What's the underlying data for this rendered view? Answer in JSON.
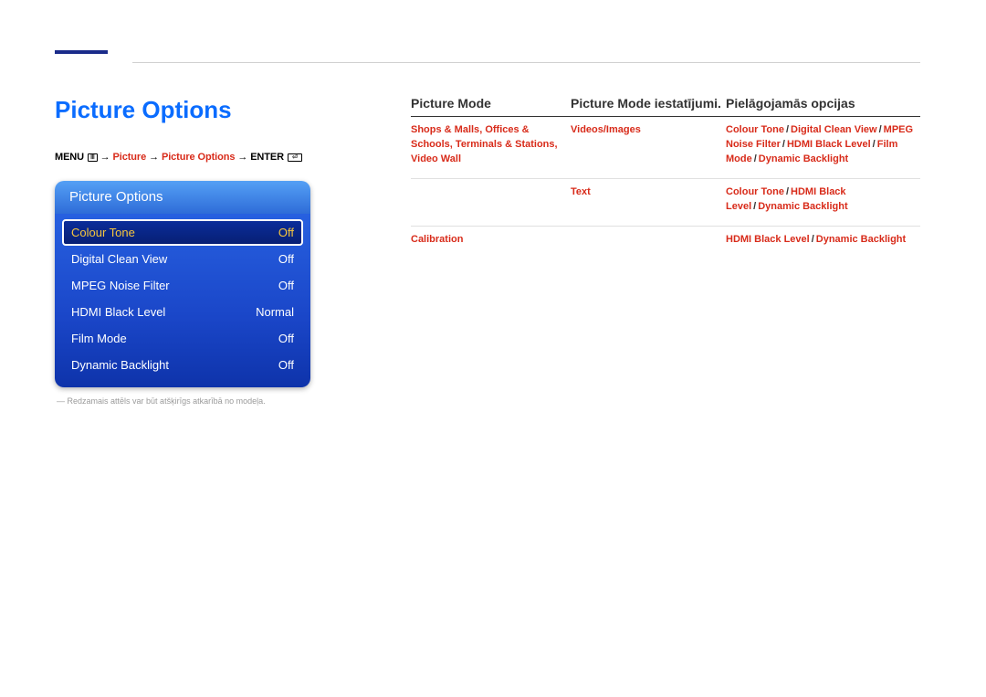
{
  "page_title": "Picture Options",
  "breadcrumb": {
    "menu": "MENU",
    "p1": "Picture",
    "p2": "Picture Options",
    "enter": "ENTER"
  },
  "menu_panel": {
    "header": "Picture Options",
    "items": [
      {
        "label": "Colour Tone",
        "value": "Off",
        "selected": true
      },
      {
        "label": "Digital Clean View",
        "value": "Off"
      },
      {
        "label": "MPEG Noise Filter",
        "value": "Off"
      },
      {
        "label": "HDMI Black Level",
        "value": "Normal"
      },
      {
        "label": "Film Mode",
        "value": "Off"
      },
      {
        "label": "Dynamic Backlight",
        "value": "Off"
      }
    ]
  },
  "footnote": "Redzamais attēls var būt atšķirīgs atkarībā no modeļa.",
  "table": {
    "headers": {
      "h1": "Picture Mode",
      "h2": "Picture Mode iestatījumi.",
      "h3": "Pielāgojamās opcijas"
    },
    "rows": [
      {
        "mode_html": "<span>Shops & Malls</span>, <span>Offices & Schools</span>, <span>Terminals & Stations</span>, <span>Video Wall</span>",
        "setting": "Videos/Images",
        "options": [
          "Colour Tone",
          "Digital Clean View",
          "MPEG Noise Filter",
          "HDMI Black Level",
          "Film Mode",
          "Dynamic Backlight"
        ]
      },
      {
        "mode_html": "",
        "setting": "Text",
        "options": [
          "Colour Tone",
          "HDMI Black Level",
          "Dynamic Backlight"
        ]
      },
      {
        "mode_html": "<span>Calibration</span>",
        "setting": "",
        "options": [
          "HDMI Black Level",
          "Dynamic Backlight"
        ]
      }
    ]
  }
}
